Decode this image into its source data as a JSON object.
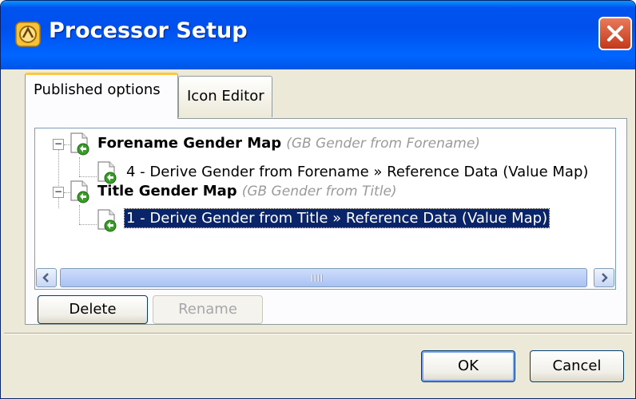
{
  "window": {
    "title": "Processor Setup",
    "icon": "processor-app-icon",
    "close": "close-icon"
  },
  "tabs": [
    {
      "label": "Published options",
      "active": true
    },
    {
      "label": "Icon Editor",
      "active": false
    }
  ],
  "tree": {
    "nodes": [
      {
        "title": "Forename Gender Map",
        "subtitle": "(GB Gender from Forename)",
        "expanded": true,
        "child": {
          "label": "4 - Derive Gender from Forename » Reference Data (Value Map)",
          "selected": false
        }
      },
      {
        "title": "Title Gender Map",
        "subtitle": "(GB Gender from Title)",
        "expanded": true,
        "child": {
          "label": "1 - Derive Gender from Title » Reference Data (Value Map)",
          "selected": true
        }
      }
    ],
    "expander_symbol": "−"
  },
  "buttons": {
    "delete": "Delete",
    "rename": "Rename",
    "ok": "OK",
    "cancel": "Cancel"
  },
  "colors": {
    "titlebar": "#0053ee",
    "selection": "#0a246a",
    "active_tab_highlight": "#ffc83c"
  }
}
